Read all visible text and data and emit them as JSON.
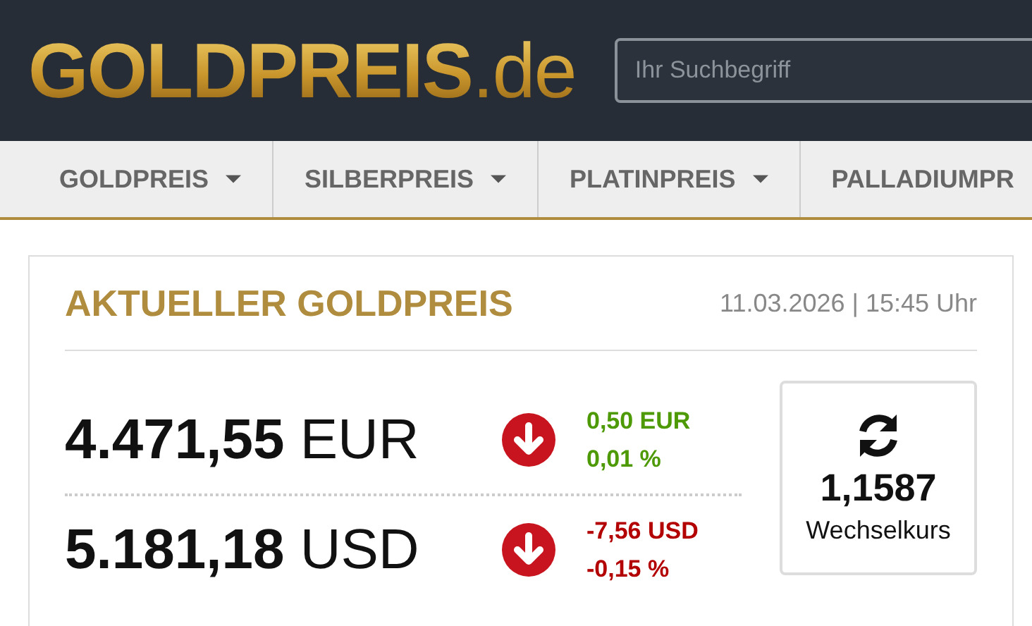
{
  "header": {
    "logo": {
      "main": "GOLDPREIS",
      "suffix": ".de"
    },
    "search": {
      "placeholder": "Ihr Suchbegriff"
    }
  },
  "nav": [
    {
      "label": "GOLDPREIS",
      "dropdown": true
    },
    {
      "label": "SILBERPREIS",
      "dropdown": true
    },
    {
      "label": "PLATINPREIS",
      "dropdown": true
    },
    {
      "label": "PALLADIUMPR",
      "dropdown": false
    }
  ],
  "card": {
    "title": "AKTUELLER GOLDPREIS",
    "timestamp": "11.03.2026 | 15:45 Uhr",
    "prices": [
      {
        "amount": "4.471,55",
        "currency": "EUR",
        "kind": "down",
        "change": "0,50 EUR",
        "percent": "0,01 %",
        "color": "#4e9a06"
      },
      {
        "amount": "5.181,18",
        "currency": "USD",
        "kind": "down",
        "change": "-7,56 USD",
        "percent": "-0,15 %",
        "color": "#b30000"
      }
    ],
    "exchange": {
      "value": "1,1587",
      "label": "Wechselkurs"
    }
  }
}
